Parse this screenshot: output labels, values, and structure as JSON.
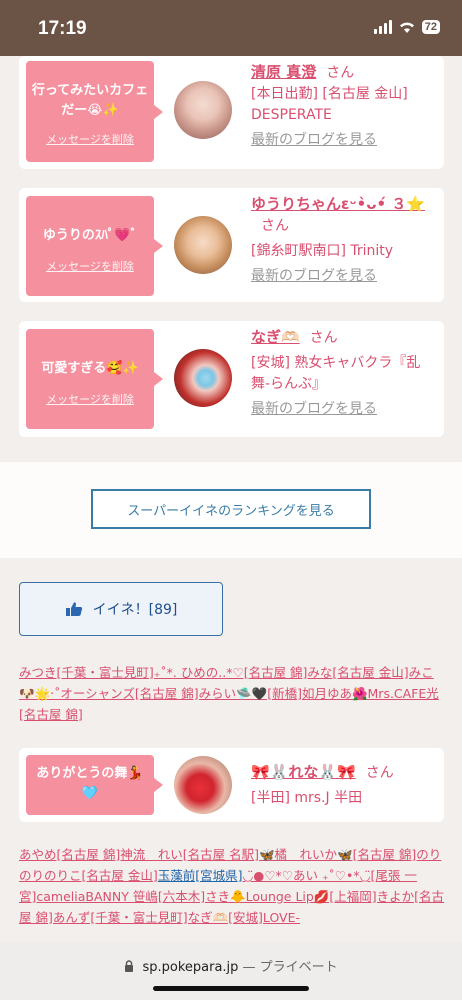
{
  "status": {
    "time": "17:19",
    "battery": "72"
  },
  "cards": [
    {
      "message": "行ってみたいカフェだー😭✨",
      "delete": "メッセージを削除",
      "name": "清原 真澄",
      "san": "さん",
      "detail": "[本日出勤] [名古屋 金山] DESPERATE",
      "blog": "最新のブログを見る"
    },
    {
      "message": "ゆうりのｽﾊﾟ💗ﾞ",
      "delete": "メッセージを削除",
      "name": "ゆうりちゃんεᵕ•̀ᴗ•́ ３⭐",
      "san": "さん",
      "detail": "[錦糸町駅南口] Trinity",
      "blog": "最新のブログを見る"
    },
    {
      "message": "可愛すぎる🥰✨",
      "delete": "メッセージを削除",
      "name": "なぎ🫶🏻",
      "san": "さん",
      "detail": "[安城] 熟女キャバクラ『乱舞-らんぶ』",
      "blog": "最新のブログを見る"
    }
  ],
  "ranking_button": "スーパーイイネのランキングを見る",
  "iine": {
    "label": "イイネ！[89]",
    "icon": "thumbs-up-icon"
  },
  "likers_text": "みつき[千葉・富士見町]₊˚*. ひめの..*♡[名古屋 錦]みな[名古屋 金山]みこ🐶🌟‧˚オーシャンズ[名古屋 錦]みらい🛸🖤[新橋]如月ゆあ🌺Mrs.CAFE光[名古屋 錦]",
  "thanks_card": {
    "message": "ありがとうの舞💃🩵",
    "name": "🎀🐰れな🐰🎀",
    "san": "さん",
    "detail": "[半田] mrs.J 半田"
  },
  "bottom_links_text": "あやめ[名古屋 錦]神流　れい[名古屋 名駅]🦋橘　れいか🦋[名古屋 錦]のりのりのりこ[名古屋 金山]",
  "bottom_links_blue": "玉藻前[宮城県]",
  "bottom_links_text2": "◡̈●♡*♡あい ₊˚♡•*◡̈[尾張 一宮]cameliaBANNY 笹嶋[六本木]さき🐥Lounge Lip💋[上福岡]きよか[名古屋 錦]あんず[千葉・富士見町]なぎ🫶🏻[安城]LOVE-",
  "footer": {
    "url": "sp.pokepara.jp",
    "privacy": "— プライベート"
  }
}
